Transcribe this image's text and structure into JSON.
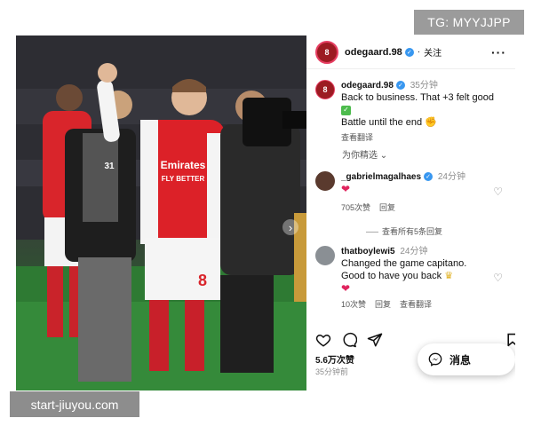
{
  "watermark": {
    "tg": "TG: MYYJJPP",
    "site": "start-jiuyou.com"
  },
  "post": {
    "header": {
      "username": "odegaard.98",
      "follow_label": "关注"
    },
    "caption": {
      "username": "odegaard.98",
      "time": "35分钟",
      "line1": "Back to business. That +3 felt good",
      "line2": "Battle until the end",
      "translate": "查看翻译"
    },
    "filter_label": "为你精选",
    "comments": [
      {
        "username": "_gabrielmagalhaes",
        "time": "24分钟",
        "likes": "705次赞",
        "reply": "回复",
        "view_replies": "查看所有5条回复"
      },
      {
        "username": "thatboylewi5",
        "time": "24分钟",
        "line1": "Changed the game capitano.",
        "line2": "Good to have you back",
        "likes": "10次赞",
        "reply": "回复",
        "translate": "查看翻译"
      }
    ],
    "likes_count": "5.6万次赞",
    "posted_time": "35分钟前",
    "message_label": "消息"
  },
  "photo": {
    "shirt_sponsor": "Emirates",
    "shirt_sponsor_sub": "FLY BETTER",
    "shorts_number": "8",
    "bib_number": "31"
  }
}
